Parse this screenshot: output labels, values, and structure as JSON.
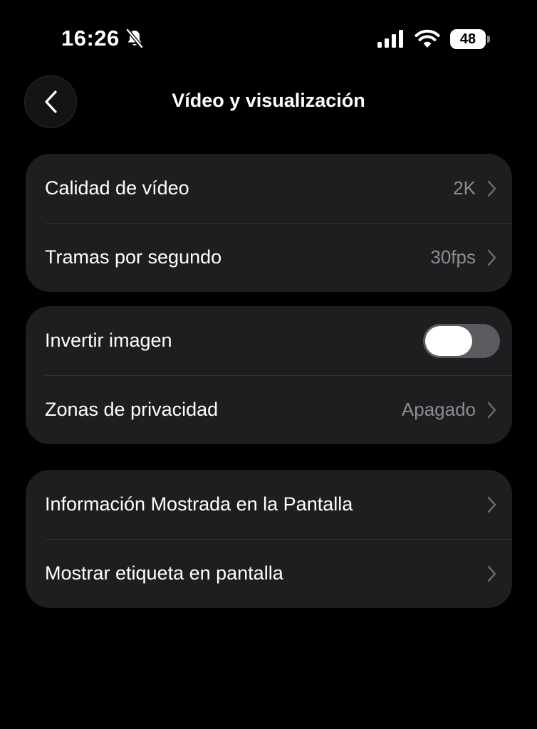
{
  "status_bar": {
    "time": "16:26",
    "battery_level": "48",
    "icons": [
      "bell-slash-icon",
      "cellular-signal-icon",
      "wifi-icon",
      "battery-icon"
    ]
  },
  "header": {
    "title": "Vídeo y visualización",
    "back_icon": "chevron-left-icon"
  },
  "sections": [
    {
      "rows": [
        {
          "label": "Calidad de vídeo",
          "value": "2K"
        },
        {
          "label": "Tramas por segundo",
          "value": "30fps"
        }
      ]
    },
    {
      "rows": [
        {
          "label": "Invertir imagen",
          "toggle_on": false
        },
        {
          "label": "Zonas de privacidad",
          "value": "Apagado"
        }
      ]
    },
    {
      "rows": [
        {
          "label": "Información Mostrada en la Pantalla"
        },
        {
          "label": "Mostrar etiqueta en pantalla"
        }
      ]
    }
  ],
  "colors": {
    "background": "#000000",
    "card": "#1e1e20",
    "secondary_text": "#8d8d92",
    "toggle_off": "#5b5b5f"
  }
}
